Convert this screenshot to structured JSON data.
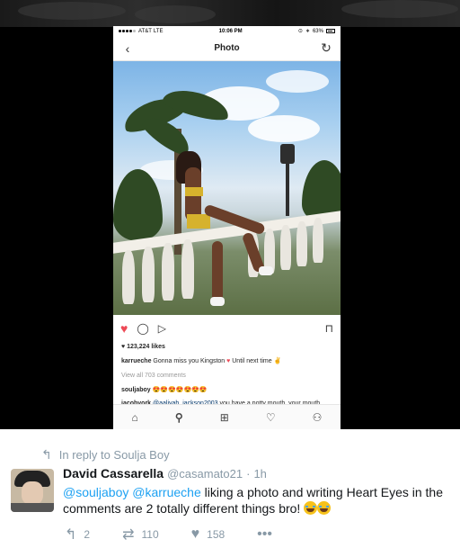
{
  "phone": {
    "status": {
      "carrier": "AT&T",
      "network": "LTE",
      "time": "10:06 PM",
      "battery": "63%"
    },
    "nav": {
      "title": "Photo",
      "back_icon": "chevron-left-icon",
      "refresh_icon": "refresh-icon"
    },
    "post": {
      "likes": "123,224 likes",
      "caption_user": "karrueche",
      "caption_text": "Gonna miss you Kingston",
      "caption_text_2": "Until next time",
      "view_comments": "View all 703 comments",
      "comment1_user": "souljaboy",
      "comment2_user": "jacobyork",
      "comment2_mention": "@aaliyah_jackson2003",
      "comment2_text": "you have a potty mouth, your mouth needs to be washed out with soap, I should contact your school and parents."
    }
  },
  "tweet": {
    "reply_to": "In reply to Soulja Boy",
    "author_name": "David Cassarella",
    "author_handle": "@casamato21",
    "time": "1h",
    "mention1": "@souljaboy",
    "mention2": "@karrueche",
    "text": "liking a photo and writing Heart Eyes in the comments are 2 totally different things bro!",
    "replies": "2",
    "retweets": "110",
    "likes": "158"
  }
}
